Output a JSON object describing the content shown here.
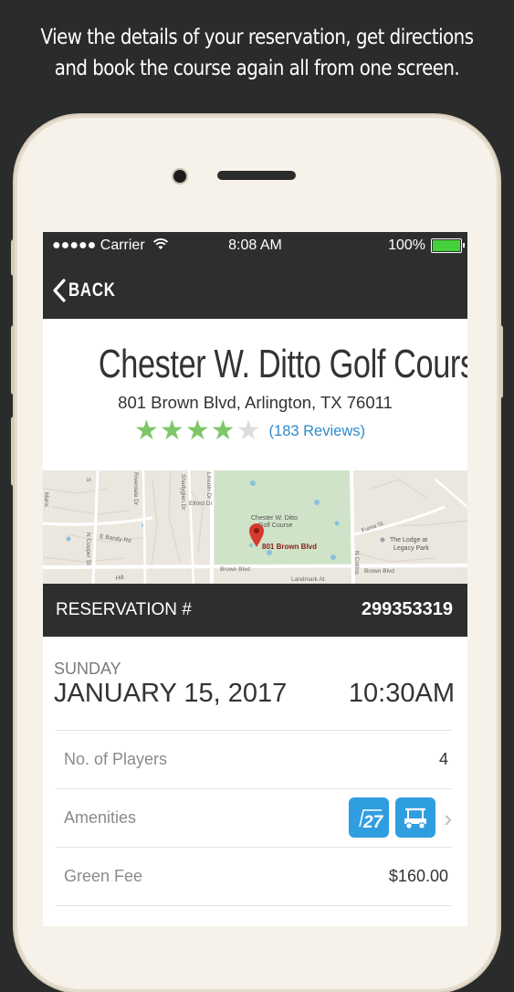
{
  "caption": {
    "line1": "View the details of your reservation, get directions",
    "line2": "and book the course again all from one screen."
  },
  "status_bar": {
    "carrier": "●●●●● Carrier",
    "time": "8:08 AM",
    "battery": "100%"
  },
  "nav": {
    "back_label": "BACK"
  },
  "course": {
    "name": "Chester W. Ditto Golf Course",
    "address": "801 Brown Blvd, Arlington, TX 76011",
    "rating": 4,
    "rating_max": 5,
    "reviews_label": "(183 Reviews)"
  },
  "map": {
    "pin_label": "801 Brown Blvd",
    "course_label_1": "Chester W. Ditto",
    "course_label_2": "Golf Course",
    "streets": [
      "Elford Dr",
      "Lincoln Dr",
      "Riverdale Dr",
      "Shadyglen Dr",
      "Maris",
      "N Cooper St",
      "E Bandy Rd",
      "Brown Blvd",
      "Landmark At",
      "Fuma St",
      "N Collins",
      "Brown Blvd",
      "Hill"
    ],
    "poi_1": "The Lodge at",
    "poi_2": "Legacy Park"
  },
  "reservation": {
    "label": "RESERVATION #",
    "number": "299353319",
    "day": "SUNDAY",
    "date": "JANUARY 15, 2017",
    "time": "10:30AM"
  },
  "details": {
    "players_label": "No. of Players",
    "players_value": "4",
    "amenities_label": "Amenities",
    "amenity_1": "27",
    "green_fee_label": "Green Fee",
    "green_fee_value": "$160.00"
  },
  "colors": {
    "dark_bar": "#2d2f2e",
    "star_on": "#7dc768",
    "star_off": "#dddddd",
    "link": "#2c8ac9",
    "amenity_bg": "#2f9ee0",
    "battery": "#45d13b"
  }
}
